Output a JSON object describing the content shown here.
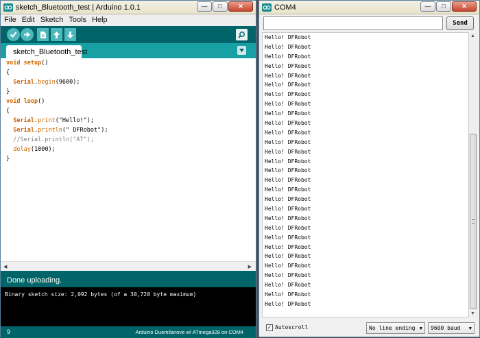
{
  "ide": {
    "title": "sketch_Bluetooth_test | Arduino 1.0.1",
    "menu": [
      "File",
      "Edit",
      "Sketch",
      "Tools",
      "Help"
    ],
    "toolbar_icons": [
      "verify-icon",
      "upload-icon",
      "new-icon",
      "open-icon",
      "save-icon",
      "serial-monitor-icon"
    ],
    "tab_label": "sketch_Bluetooth_test",
    "code": [
      {
        "parts": [
          {
            "t": "void ",
            "c": "kw"
          },
          {
            "t": "setup",
            "c": "kw"
          },
          {
            "t": "()",
            "c": ""
          }
        ]
      },
      {
        "parts": [
          {
            "t": "{",
            "c": ""
          }
        ]
      },
      {
        "parts": [
          {
            "t": "  ",
            "c": ""
          },
          {
            "t": "Serial",
            "c": "kw"
          },
          {
            "t": ".",
            "c": ""
          },
          {
            "t": "begin",
            "c": "fn"
          },
          {
            "t": "(9600);",
            "c": ""
          }
        ]
      },
      {
        "parts": [
          {
            "t": "}",
            "c": ""
          }
        ]
      },
      {
        "parts": [
          {
            "t": "void ",
            "c": "kw"
          },
          {
            "t": "loop",
            "c": "kw"
          },
          {
            "t": "()",
            "c": ""
          }
        ]
      },
      {
        "parts": [
          {
            "t": "{",
            "c": ""
          }
        ]
      },
      {
        "parts": [
          {
            "t": "  ",
            "c": ""
          },
          {
            "t": "Serial",
            "c": "kw"
          },
          {
            "t": ".",
            "c": ""
          },
          {
            "t": "print",
            "c": "fn"
          },
          {
            "t": "(\"Hello!\");",
            "c": ""
          }
        ]
      },
      {
        "parts": [
          {
            "t": "  ",
            "c": ""
          },
          {
            "t": "Serial",
            "c": "kw"
          },
          {
            "t": ".",
            "c": ""
          },
          {
            "t": "println",
            "c": "fn"
          },
          {
            "t": "(\" DFRobot\");",
            "c": ""
          }
        ]
      },
      {
        "parts": [
          {
            "t": "  //Serial.println(\"AT\");",
            "c": "cm"
          }
        ]
      },
      {
        "parts": [
          {
            "t": "  ",
            "c": ""
          },
          {
            "t": "delay",
            "c": "fn"
          },
          {
            "t": "(1000);",
            "c": ""
          }
        ]
      },
      {
        "parts": [
          {
            "t": "}",
            "c": ""
          }
        ]
      }
    ],
    "status": "Done uploading.",
    "console_text": "Binary sketch size: 2,092 bytes (of a 30,720 byte maximum)",
    "line_number": "9",
    "board_info": "Arduino Duemilanove w/ ATmega328 on COM4"
  },
  "monitor": {
    "title": "COM4",
    "send_label": "Send",
    "input_value": "",
    "lines": [
      "Hello! DFRobot",
      "Hello! DFRobot",
      "Hello! DFRobot",
      "Hello! DFRobot",
      "Hello! DFRobot",
      "Hello! DFRobot",
      "Hello! DFRobot",
      "Hello! DFRobot",
      "Hello! DFRobot",
      "Hello! DFRobot",
      "Hello! DFRobot",
      "Hello! DFRobot",
      "Hello! DFRobot",
      "Hello! DFRobot",
      "Hello! DFRobot",
      "Hello! DFRobot",
      "Hello! DFRobot",
      "Hello! DFRobot",
      "Hello! DFRobot",
      "Hello! DFRobot",
      "Hello! DFRobot",
      "Hello! DFRobot",
      "Hello! DFRobot",
      "Hello! DFRobot",
      "Hello! DFRobot",
      "Hello! DFRobot",
      "Hello! DFRobot",
      "Hello! DFRobot",
      "Hello! DFRobot"
    ],
    "autoscroll_label": "Autoscroll",
    "autoscroll_checked": true,
    "line_ending": "No line ending",
    "baud": "9600 baud"
  },
  "colors": {
    "teal_dark": "#006468",
    "teal_light": "#17a1a5",
    "keyword": "#cc6600"
  }
}
